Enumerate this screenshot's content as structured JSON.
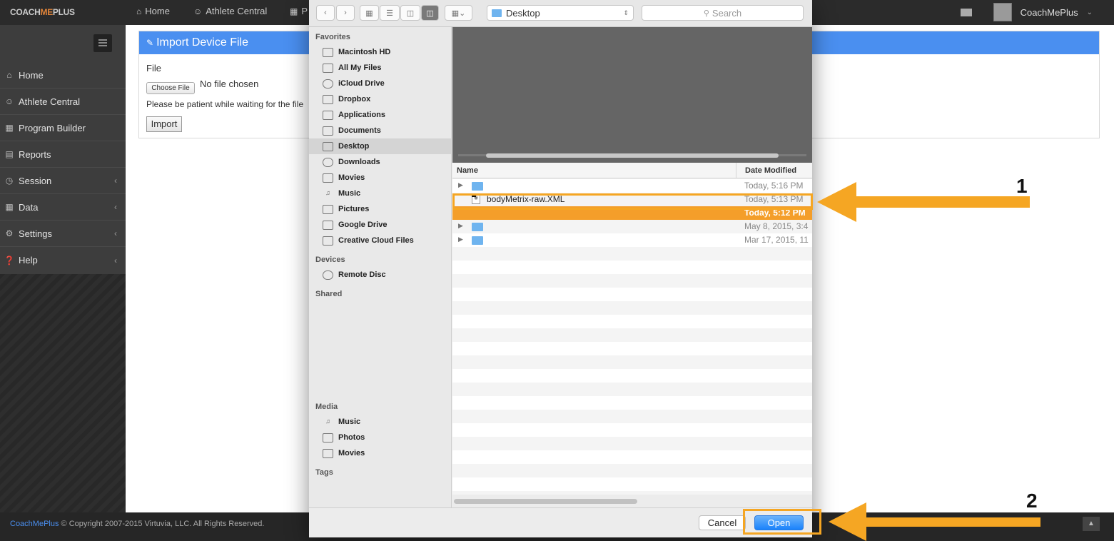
{
  "app": {
    "logo_part1": "COACH",
    "logo_part2": "ME",
    "logo_part3": "PLUS",
    "topnav": [
      {
        "label": "Home",
        "icon": "home-icon"
      },
      {
        "label": "Athlete Central",
        "icon": "users-icon"
      },
      {
        "label": "P",
        "icon": "calendar-icon"
      }
    ],
    "user_name": "CoachMePlus"
  },
  "sidebar": {
    "items": [
      {
        "label": "Home",
        "icon": "home-icon",
        "has_arrow": false
      },
      {
        "label": "Athlete Central",
        "icon": "users-icon",
        "has_arrow": false
      },
      {
        "label": "Program Builder",
        "icon": "calendar-icon",
        "has_arrow": false
      },
      {
        "label": "Reports",
        "icon": "bar-chart-icon",
        "has_arrow": false
      },
      {
        "label": "Session",
        "icon": "clock-icon",
        "has_arrow": true
      },
      {
        "label": "Data",
        "icon": "table-icon",
        "has_arrow": true
      },
      {
        "label": "Settings",
        "icon": "gears-icon",
        "has_arrow": true
      },
      {
        "label": "Help",
        "icon": "question-icon",
        "has_arrow": true
      }
    ]
  },
  "panel": {
    "title": "Import Device File",
    "file_label": "File",
    "choose_file": "Choose File",
    "no_file": "No file chosen",
    "patient_text": "Please be patient while waiting for the file",
    "import_label": "Import"
  },
  "footer": {
    "brand": "CoachMePlus",
    "copyright": "© Copyright 2007-2015 Virtuvia, LLC. All Rights Reserved."
  },
  "dialog": {
    "location": "Desktop",
    "search_placeholder": "Search",
    "sections": {
      "favorites": "Favorites",
      "devices": "Devices",
      "shared": "Shared",
      "media": "Media",
      "tags": "Tags"
    },
    "favorites": [
      {
        "label": "Macintosh HD",
        "icon": "harddrive-icon"
      },
      {
        "label": "All My Files",
        "icon": "allfiles-icon"
      },
      {
        "label": "iCloud Drive",
        "icon": "cloud-icon"
      },
      {
        "label": "Dropbox",
        "icon": "dropbox-icon"
      },
      {
        "label": "Applications",
        "icon": "applications-icon"
      },
      {
        "label": "Documents",
        "icon": "documents-icon"
      },
      {
        "label": "Desktop",
        "icon": "desktop-icon",
        "selected": true
      },
      {
        "label": "Downloads",
        "icon": "downloads-icon"
      },
      {
        "label": "Movies",
        "icon": "movies-icon"
      },
      {
        "label": "Music",
        "icon": "music-icon"
      },
      {
        "label": "Pictures",
        "icon": "camera-icon"
      },
      {
        "label": "Google Drive",
        "icon": "folder-icon"
      },
      {
        "label": "Creative Cloud Files",
        "icon": "folder-icon"
      }
    ],
    "devices": [
      {
        "label": "Remote Disc",
        "icon": "disc-icon"
      }
    ],
    "media": [
      {
        "label": "Music",
        "icon": "music-icon"
      },
      {
        "label": "Photos",
        "icon": "camera-icon"
      },
      {
        "label": "Movies",
        "icon": "movies-icon"
      }
    ],
    "columns": {
      "name": "Name",
      "date": "Date Modified"
    },
    "files": [
      {
        "name": "",
        "date": "Today, 5:16 PM",
        "type": "folder",
        "expandable": true
      },
      {
        "name": "bodyMetrix-raw.XML",
        "date": "Today, 5:13 PM",
        "type": "document"
      },
      {
        "name": "",
        "date": "Today, 5:12 PM",
        "type": "file",
        "selected": true
      },
      {
        "name": "",
        "date": "May 8, 2015, 3:4",
        "type": "folder",
        "expandable": true
      },
      {
        "name": "",
        "date": "Mar 17, 2015, 11",
        "type": "folder",
        "expandable": true
      }
    ],
    "cancel_label": "Cancel",
    "open_label": "Open"
  },
  "annotations": {
    "step1": "1",
    "step2": "2",
    "color": "#f5a623"
  }
}
